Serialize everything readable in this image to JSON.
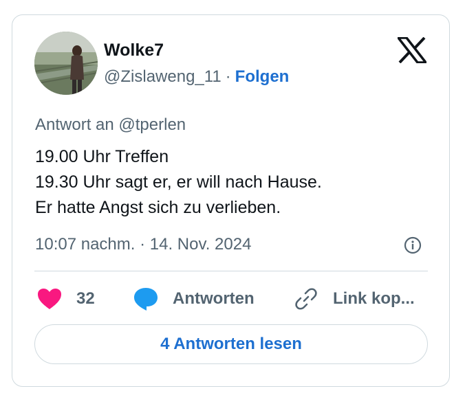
{
  "tweet": {
    "author_name": "Wolke7",
    "handle": "@Zislaweng_11",
    "separator": "·",
    "follow_label": "Folgen",
    "reply_to": "Antwort an @tperlen",
    "lines": [
      "19.00 Uhr Treffen",
      "19.30 Uhr sagt er, er will nach Hause.",
      "Er hatte Angst sich zu verlieben."
    ],
    "timestamp": "10:07 nachm. · 14. Nov. 2024"
  },
  "actions": {
    "like_count": "32",
    "reply_label": "Antworten",
    "copy_link_label": "Link kop..."
  },
  "read_replies_label": "4 Antworten lesen",
  "icons": {
    "brand": "x-logo-icon",
    "info": "info-icon",
    "like": "heart-icon",
    "reply": "speech-bubble-icon",
    "link": "link-icon"
  },
  "colors": {
    "text": "#0f1419",
    "secondary": "#536471",
    "accent": "#1d6fd0",
    "heart": "#f91880",
    "reply_bubble": "#1d9bf0",
    "border": "#cfd9de"
  }
}
